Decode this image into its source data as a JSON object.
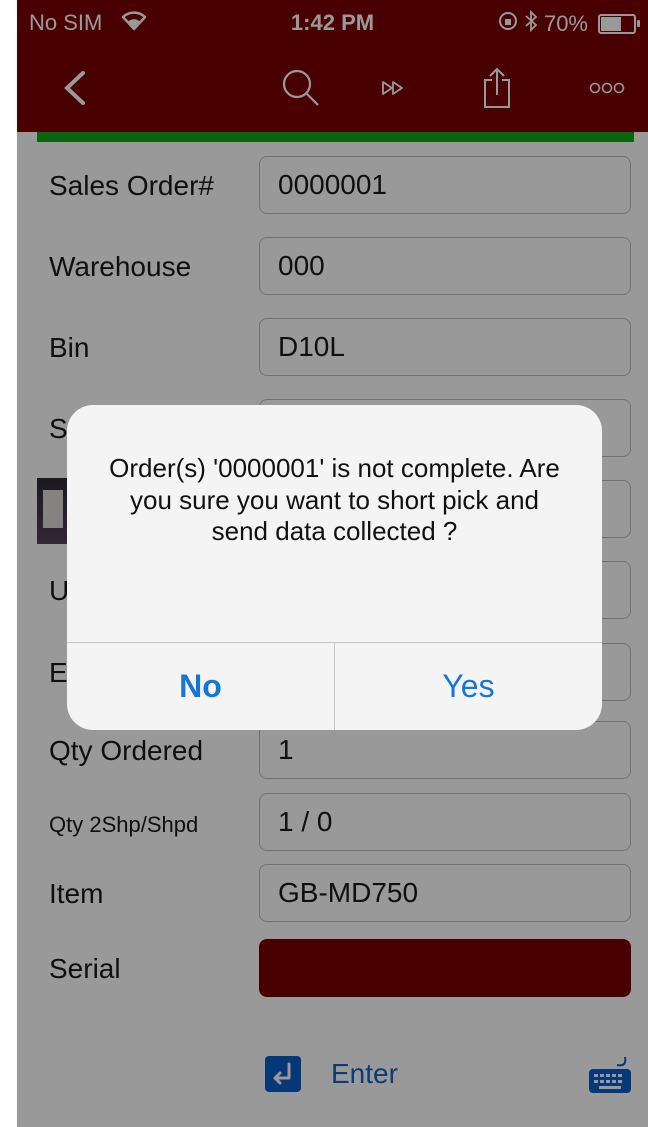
{
  "status_bar": {
    "carrier": "No SIM",
    "time": "1:42 PM",
    "battery": "70%",
    "battery_level": 0.7
  },
  "nav": {
    "back_icon": "chevron-left-icon",
    "search_icon": "search-icon",
    "fast_forward_icon": "fast-forward-icon",
    "share_icon": "share-icon",
    "more_icon": "more-icon"
  },
  "colors": {
    "brand": "#7b0000",
    "accent_green": "#11a81a",
    "link_blue": "#1676d8"
  },
  "form": {
    "sales_order_label": "Sales Order#",
    "sales_order_value": "0000001",
    "warehouse_label": "Warehouse",
    "warehouse_value": "000",
    "bin_label": "Bin",
    "bin_value": "D10L",
    "row4_label": "S",
    "row6_label": "U",
    "row7_label": "E",
    "qty_ordered_label": "Qty Ordered",
    "qty_ordered_value": "1",
    "qty_ship_label": "Qty 2Shp/Shpd",
    "qty_ship_value": "1 / 0",
    "item_label": "Item",
    "item_value": "GB-MD750",
    "serial_label": "Serial",
    "serial_value": ""
  },
  "footer": {
    "enter_label": "Enter",
    "keyboard_icon": "keyboard-icon"
  },
  "alert": {
    "message": "Order(s) '0000001' is not complete. Are you sure you want to short pick and send data collected ?",
    "no_label": "No",
    "yes_label": "Yes"
  }
}
